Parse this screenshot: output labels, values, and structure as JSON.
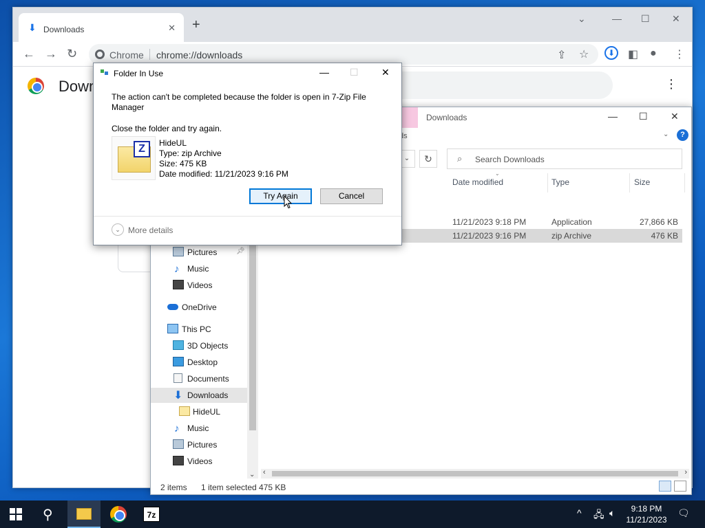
{
  "chrome": {
    "tab_title": "Downloads",
    "omnibox_site": "Chrome",
    "omnibox_url": "chrome://downloads",
    "page_heading": "Downloads"
  },
  "explorer": {
    "title": "Downloads",
    "search_placeholder": "Search Downloads",
    "breadcrumb_fragment": "ds",
    "columns": [
      "Date modified",
      "Type",
      "Size"
    ],
    "rows": [
      {
        "date": "11/21/2023 9:18 PM",
        "type": "Application",
        "size": "27,866 KB",
        "selected": false
      },
      {
        "date": "11/21/2023 9:16 PM",
        "type": "zip Archive",
        "size": "476 KB",
        "selected": true
      }
    ],
    "nav_items": [
      {
        "label": "Pictures",
        "pinned": true,
        "icon": "pictures-icon"
      },
      {
        "label": "Music",
        "icon": "music-icon"
      },
      {
        "label": "Videos",
        "icon": "videos-icon"
      },
      {
        "label": "OneDrive",
        "icon": "onedrive-icon"
      },
      {
        "label": "This PC",
        "icon": "this-pc-icon"
      },
      {
        "label": "3D Objects",
        "icon": "3d-objects-icon"
      },
      {
        "label": "Desktop",
        "icon": "desktop-icon"
      },
      {
        "label": "Documents",
        "icon": "documents-icon"
      },
      {
        "label": "Downloads",
        "icon": "downloads-icon",
        "active": true
      },
      {
        "label": "HideUL",
        "icon": "zip-icon"
      },
      {
        "label": "Music",
        "icon": "music-icon"
      },
      {
        "label": "Pictures",
        "icon": "pictures-icon"
      },
      {
        "label": "Videos",
        "icon": "videos-icon"
      }
    ],
    "status_items": "2 items",
    "status_selected": "1 item selected",
    "status_size": "475 KB"
  },
  "dialog": {
    "title": "Folder In Use",
    "message": "The action can't be completed because the folder is open in 7-Zip File Manager",
    "instruction": "Close the folder and try again.",
    "file_name": "HideUL",
    "file_type": "Type: zip Archive",
    "file_size": "Size: 475 KB",
    "file_date": "Date modified: 11/21/2023 9:16 PM",
    "try_again_label": "Try Again",
    "cancel_label": "Cancel",
    "more_details_label": "More details"
  },
  "taskbar": {
    "time": "9:18 PM",
    "date": "11/21/2023",
    "sevenzip_label": "7z"
  },
  "colors": {
    "accent": "#0078d7",
    "chrome_blue": "#1a73e8",
    "selected_row": "#d9d9d9",
    "taskbar": "#0e1a2b"
  }
}
